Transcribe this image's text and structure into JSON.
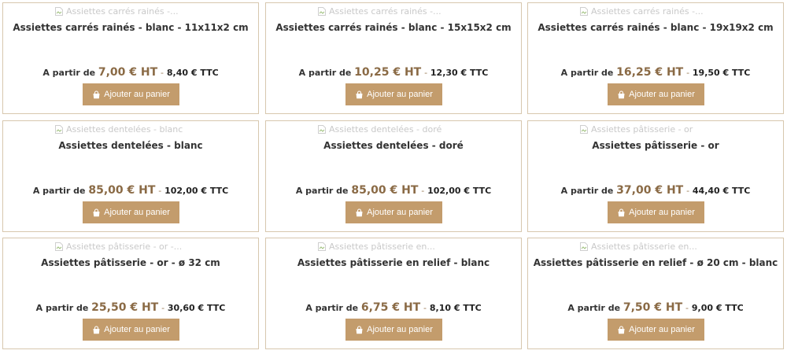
{
  "products": [
    {
      "img_alt": "Assiettes carrés rainés -...",
      "title": "Assiettes carrés rainés - blanc - 11x11x2 cm",
      "price_prefix": "A partir de",
      "price_ht": "7,00 € HT",
      "sep": "-",
      "price_ttc": "8,40 € TTC",
      "button_label": "Ajouter au panier"
    },
    {
      "img_alt": "Assiettes carrés rainés -...",
      "title": "Assiettes carrés rainés - blanc - 15x15x2 cm",
      "price_prefix": "A partir de",
      "price_ht": "10,25 € HT",
      "sep": "-",
      "price_ttc": "12,30 € TTC",
      "button_label": "Ajouter au panier"
    },
    {
      "img_alt": "Assiettes carrés rainés -...",
      "title": "Assiettes carrés rainés - blanc - 19x19x2 cm",
      "price_prefix": "A partir de",
      "price_ht": "16,25 € HT",
      "sep": "-",
      "price_ttc": "19,50 € TTC",
      "button_label": "Ajouter au panier"
    },
    {
      "img_alt": "Assiettes dentelées - blanc",
      "title": "Assiettes dentelées - blanc",
      "price_prefix": "A partir de",
      "price_ht": "85,00 € HT",
      "sep": "-",
      "price_ttc": "102,00 € TTC",
      "button_label": "Ajouter au panier"
    },
    {
      "img_alt": "Assiettes dentelées - doré",
      "title": "Assiettes dentelées - doré",
      "price_prefix": "A partir de",
      "price_ht": "85,00 € HT",
      "sep": "-",
      "price_ttc": "102,00 € TTC",
      "button_label": "Ajouter au panier"
    },
    {
      "img_alt": "Assiettes pâtisserie - or",
      "title": "Assiettes pâtisserie - or",
      "price_prefix": "A partir de",
      "price_ht": "37,00 € HT",
      "sep": "-",
      "price_ttc": "44,40 € TTC",
      "button_label": "Ajouter au panier"
    },
    {
      "img_alt": "Assiettes pâtisserie - or -...",
      "title": "Assiettes pâtisserie - or - ø 32 cm",
      "price_prefix": "A partir de",
      "price_ht": "25,50 € HT",
      "sep": "-",
      "price_ttc": "30,60 € TTC",
      "button_label": "Ajouter au panier"
    },
    {
      "img_alt": "Assiettes pâtisserie en...",
      "title": "Assiettes pâtisserie en relief - blanc",
      "price_prefix": "A partir de",
      "price_ht": "6,75 € HT",
      "sep": "-",
      "price_ttc": "8,10 € TTC",
      "button_label": "Ajouter au panier"
    },
    {
      "img_alt": "Assiettes pâtisserie en...",
      "title": "Assiettes pâtisserie en relief - ø 20 cm - blanc",
      "price_prefix": "A partir de",
      "price_ht": "7,50 € HT",
      "sep": "-",
      "price_ttc": "9,00 € TTC",
      "button_label": "Ajouter au panier"
    }
  ],
  "colors": {
    "card_border": "#d7c7ae",
    "button_bg": "#c39c6c",
    "price_ht": "#8a6a45"
  },
  "icons": {
    "image_placeholder": "broken-image-icon",
    "button": "shopping-bag-icon"
  }
}
